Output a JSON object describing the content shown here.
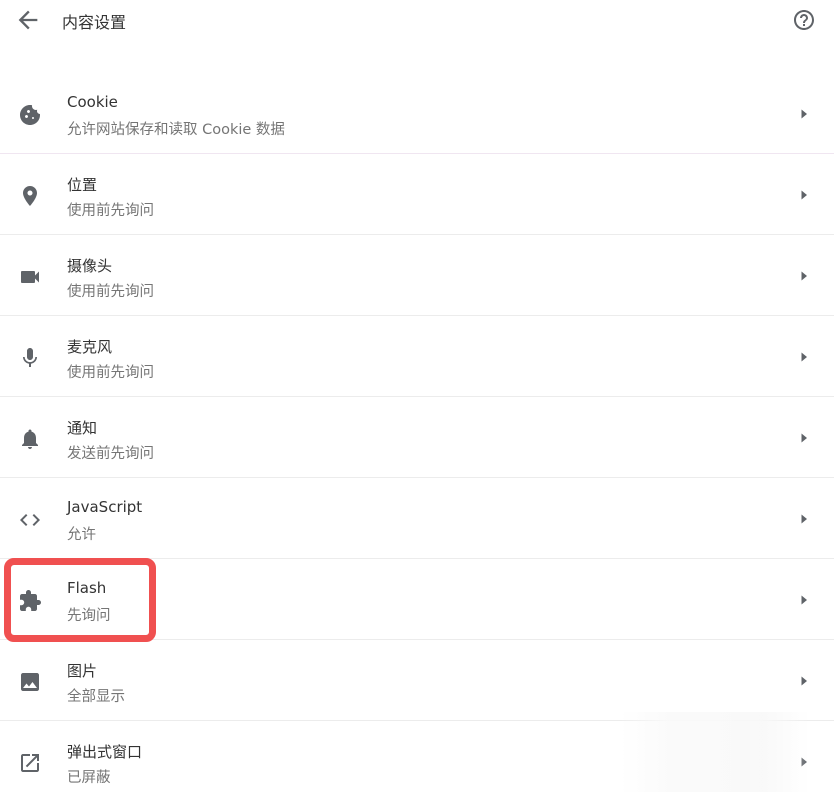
{
  "header": {
    "title": "内容设置",
    "back_icon": "arrow-back-icon",
    "help_icon": "help-circle-icon"
  },
  "colors": {
    "highlight": "#f05050",
    "icon": "#5f6368",
    "divider": "#ececec"
  },
  "settings": [
    {
      "title": "Cookie",
      "subtitle": "允许网站保存和读取 Cookie 数据",
      "icon": "cookie-icon"
    },
    {
      "title": "位置",
      "subtitle": "使用前先询问",
      "icon": "location-pin-icon"
    },
    {
      "title": "摄像头",
      "subtitle": "使用前先询问",
      "icon": "camera-icon"
    },
    {
      "title": "麦克风",
      "subtitle": "使用前先询问",
      "icon": "microphone-icon"
    },
    {
      "title": "通知",
      "subtitle": "发送前先询问",
      "icon": "bell-icon"
    },
    {
      "title": "JavaScript",
      "subtitle": "允许",
      "icon": "code-icon"
    },
    {
      "title": "Flash",
      "subtitle": "先询问",
      "icon": "puzzle-icon"
    },
    {
      "title": "图片",
      "subtitle": "全部显示",
      "icon": "image-icon"
    },
    {
      "title": "弹出式窗口",
      "subtitle": "已屏蔽",
      "icon": "open-in-new-icon"
    }
  ]
}
